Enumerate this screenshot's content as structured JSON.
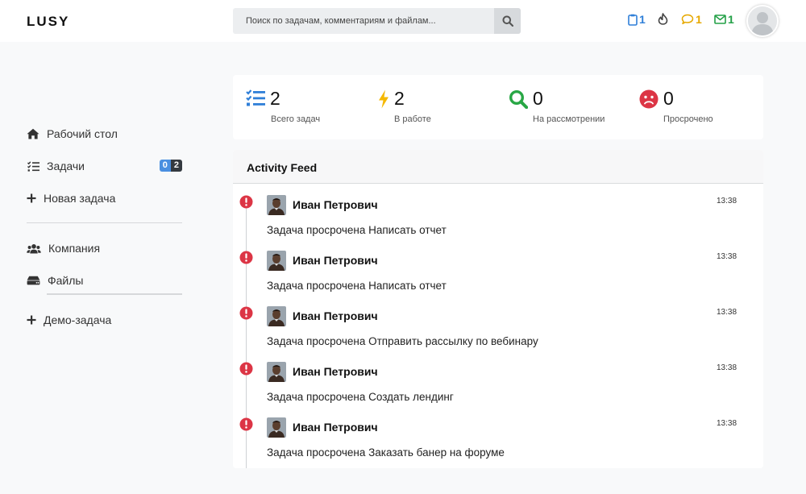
{
  "header": {
    "logo": "LUSY",
    "search_placeholder": "Поиск по задачам, комментариям и файлам...",
    "notifications": [
      {
        "icon": "clipboard-icon",
        "count": "1",
        "color": "#2f7fd8"
      },
      {
        "icon": "fire-icon",
        "count": "",
        "color": "#444444"
      },
      {
        "icon": "comment-icon",
        "count": "1",
        "color": "#e6a800"
      },
      {
        "icon": "envelope-icon",
        "count": "1",
        "color": "#23a047"
      }
    ]
  },
  "sidebar": {
    "items": [
      {
        "icon": "home-icon",
        "label": "Рабочий стол"
      },
      {
        "icon": "task-list-icon",
        "label": "Задачи",
        "badges": [
          "0",
          "2"
        ]
      },
      {
        "icon": "plus-icon",
        "label": "Новая задача"
      },
      {
        "icon": "users-icon",
        "label": "Компания"
      },
      {
        "icon": "drive-icon",
        "label": "Файлы"
      },
      {
        "icon": "plus-icon",
        "label": "Демо-задача"
      }
    ]
  },
  "stats": [
    {
      "icon": "task-list-icon",
      "value": "2",
      "label": "Всего задач",
      "color": "#2f7fd8"
    },
    {
      "icon": "bolt-icon",
      "value": "2",
      "label": "В работе",
      "color": "#f5b800"
    },
    {
      "icon": "search-icon",
      "value": "0",
      "label": "На рассмотрении",
      "color": "#28a745"
    },
    {
      "icon": "sad-face-icon",
      "value": "0",
      "label": "Просрочено",
      "color": "#dc3545"
    }
  ],
  "feed": {
    "title": "Activity Feed",
    "entries": [
      {
        "user": "Иван Петрович",
        "time": "13:38",
        "message": "Задача просрочена Написать отчет"
      },
      {
        "user": "Иван Петрович",
        "time": "13:38",
        "message": "Задача просрочена Написать отчет"
      },
      {
        "user": "Иван Петрович",
        "time": "13:38",
        "message": "Задача просрочена Отправить рассылку по вебинару"
      },
      {
        "user": "Иван Петрович",
        "time": "13:38",
        "message": "Задача просрочена Создать лендинг"
      },
      {
        "user": "Иван Петрович",
        "time": "13:38",
        "message": "Задача просрочена Заказать банер на форуме"
      }
    ]
  },
  "colors": {
    "alert": "#dc3545",
    "accent": "#2f7fd8"
  }
}
